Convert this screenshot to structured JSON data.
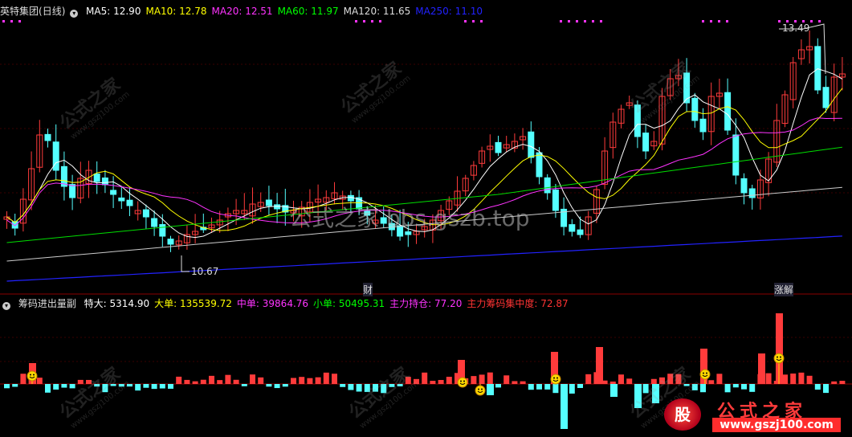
{
  "main_header": {
    "stock_name": "英特集团",
    "period": "(日线)",
    "ma_items": [
      {
        "label": "MA5: 12.90",
        "color": "#ffffff"
      },
      {
        "label": "MA10: 12.78",
        "color": "#ffff00"
      },
      {
        "label": "MA20: 12.51",
        "color": "#ff33ff"
      },
      {
        "label": "MA60: 11.97",
        "color": "#00ff00"
      },
      {
        "label": "MA120: 11.65",
        "color": "#dddddd"
      },
      {
        "label": "MA250: 11.10",
        "color": "#2222ff"
      }
    ]
  },
  "sub_header": {
    "indicator_name": "筹码进出量副",
    "items": [
      {
        "label": "特大: 5314.90",
        "color": "#ffffff"
      },
      {
        "label": "大单: 135539.72",
        "color": "#ffff00"
      },
      {
        "label": "中单: 39864.76",
        "color": "#ff33ff"
      },
      {
        "label": "小单: 50495.31",
        "color": "#00ff00"
      },
      {
        "label": "主力持仓: 77.20",
        "color": "#ff33ff"
      },
      {
        "label": "主力筹码集中度: 72.87",
        "color": "#ff3333"
      }
    ]
  },
  "annotations": {
    "high_price": "13.49",
    "low_price": "10.67",
    "event_cai": "财",
    "event_zhangjie": "涨解"
  },
  "watermarks": {
    "main": "公式之家 bbs.gszb.top",
    "site_cn": "公式之家",
    "site_url": "www.gszj100.com"
  },
  "logo": {
    "badge": "股",
    "title": "公式之家",
    "url": "www.gszj100.com"
  },
  "colors": {
    "up": "#ff3b3b",
    "down": "#54ffff",
    "axis_line": "#8b0000",
    "grid": "#3a0000",
    "ma5": "#ffffff",
    "ma10": "#ffff00",
    "ma20": "#ff33ff",
    "ma60": "#00dd00",
    "ma120": "#cccccc",
    "ma250": "#2222ff",
    "marker": "#ff33ff"
  }
}
